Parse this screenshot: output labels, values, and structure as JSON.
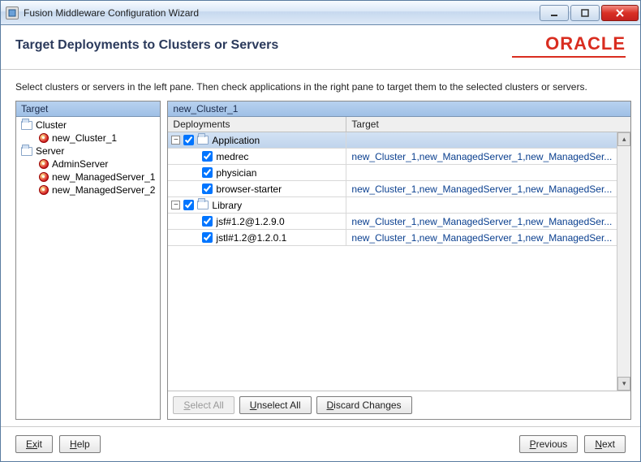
{
  "window": {
    "title": "Fusion Middleware Configuration Wizard"
  },
  "header": {
    "title": "Target Deployments to Clusters or Servers",
    "brand": "ORACLE"
  },
  "instructions": "Select clusters or servers in the left pane. Then check applications in the right pane to target them to the selected clusters or servers.",
  "left_pane": {
    "title": "Target",
    "groups": [
      {
        "label": "Cluster",
        "items": [
          {
            "label": "new_Cluster_1"
          }
        ]
      },
      {
        "label": "Server",
        "items": [
          {
            "label": "AdminServer"
          },
          {
            "label": "new_ManagedServer_1"
          },
          {
            "label": "new_ManagedServer_2"
          }
        ]
      }
    ]
  },
  "right_pane": {
    "title": "new_Cluster_1",
    "columns": {
      "deployments": "Deployments",
      "target": "Target"
    },
    "groups": [
      {
        "label": "Application",
        "expanded": true,
        "checked": true,
        "items": [
          {
            "label": "medrec",
            "checked": true,
            "target": "new_Cluster_1,new_ManagedServer_1,new_ManagedSer..."
          },
          {
            "label": "physician",
            "checked": true,
            "target": ""
          },
          {
            "label": "browser-starter",
            "checked": true,
            "target": "new_Cluster_1,new_ManagedServer_1,new_ManagedSer..."
          }
        ]
      },
      {
        "label": "Library",
        "expanded": true,
        "checked": true,
        "items": [
          {
            "label": "jsf#1.2@1.2.9.0",
            "checked": true,
            "target": "new_Cluster_1,new_ManagedServer_1,new_ManagedSer..."
          },
          {
            "label": "jstl#1.2@1.2.0.1",
            "checked": true,
            "target": "new_Cluster_1,new_ManagedServer_1,new_ManagedSer..."
          }
        ]
      }
    ],
    "buttons": {
      "select_all": "Select All",
      "unselect_all": "Unselect All",
      "discard": "Discard Changes"
    }
  },
  "footer": {
    "exit": "Exit",
    "help": "Help",
    "previous": "Previous",
    "next": "Next"
  }
}
